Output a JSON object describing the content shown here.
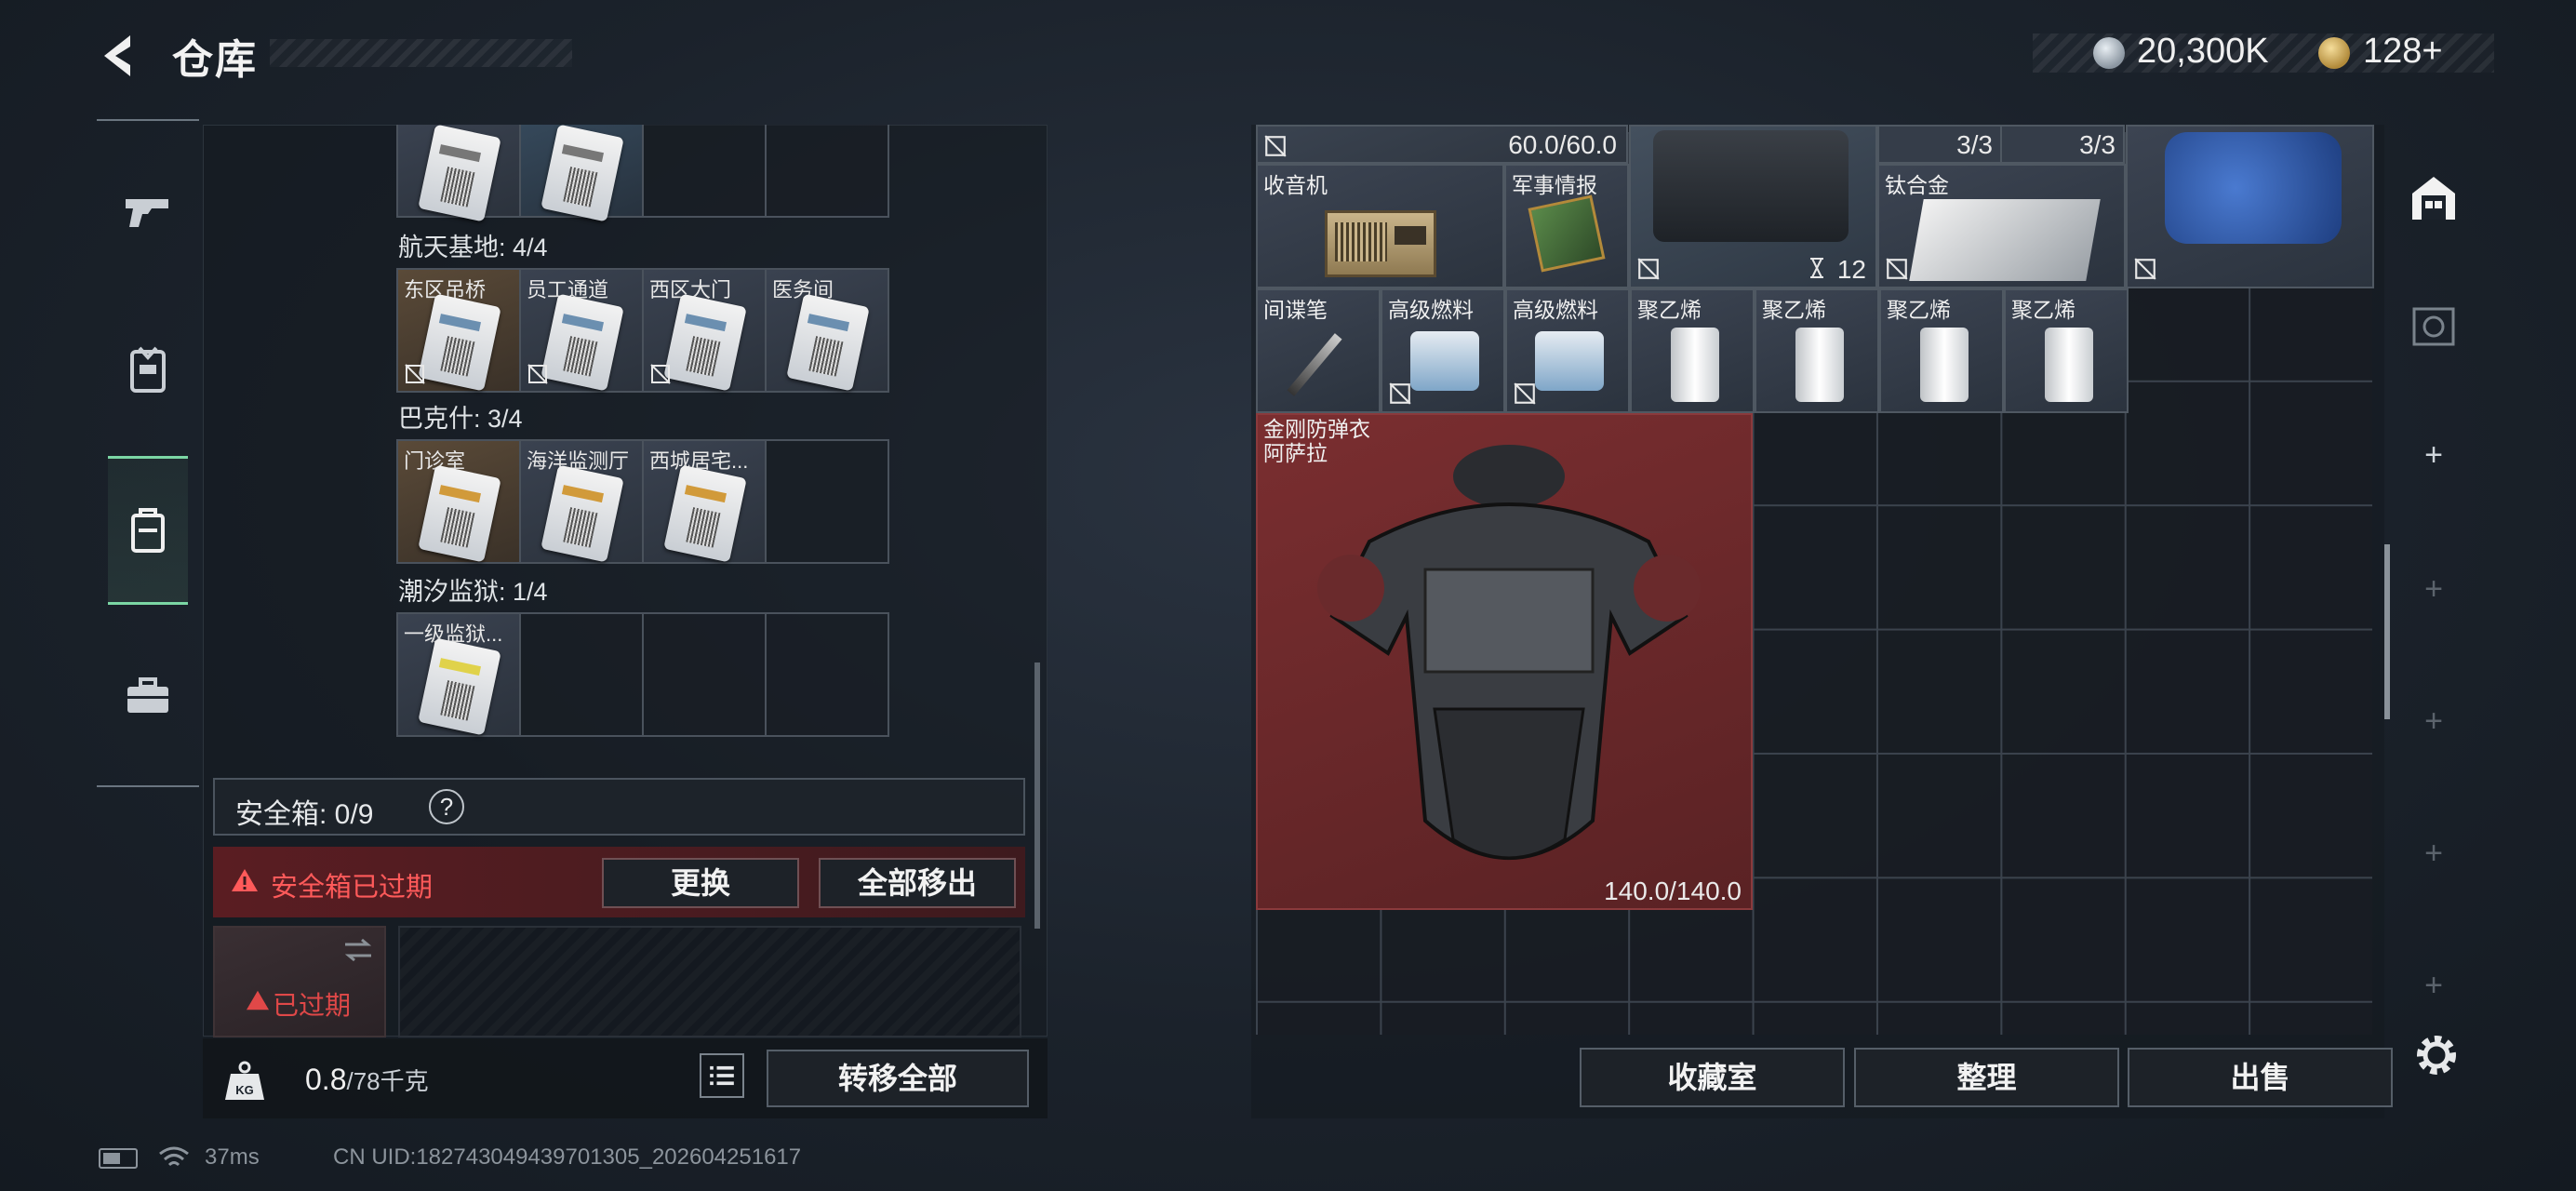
{
  "header": {
    "title": "仓库",
    "silver_amount": "20,300K",
    "gold_amount": "128+"
  },
  "left_panel": {
    "top_partial_row": [
      "",
      ""
    ],
    "sections": [
      {
        "label": "航天基地: 4/4",
        "cards": [
          "东区吊桥",
          "员工通道",
          "西区大门",
          "医务间"
        ]
      },
      {
        "label": "巴克什: 3/4",
        "cards": [
          "门诊室",
          "海洋监测厅",
          "西城居宅..."
        ]
      },
      {
        "label": "潮汐监狱: 1/4",
        "cards": [
          "一级监狱..."
        ]
      }
    ],
    "safe_box": {
      "title": "安全箱: 0/9",
      "help": "?",
      "warning": "安全箱已过期",
      "swap_label": "更换",
      "move_all_label": "全部移出",
      "expired_label": "已过期"
    },
    "bottom": {
      "weight_current": "0.8",
      "weight_max": "/78千克",
      "transfer_all_label": "转移全部"
    }
  },
  "right_panel": {
    "top_row": {
      "durability": "60.0/60.0",
      "count_a": "3/3",
      "count_b": "3/3"
    },
    "items": {
      "radio": "收音机",
      "intel": "军事情报",
      "bag_count": "12",
      "titanium": "钛合金",
      "spy_pen": "间谍笔",
      "fuel_1": "高级燃料",
      "fuel_2": "高级燃料",
      "pe_1": "聚乙烯",
      "pe_2": "聚乙烯",
      "pe_3": "聚乙烯",
      "pe_4": "聚乙烯",
      "armor_name_1": "金刚防弹衣",
      "armor_name_2": "阿萨拉",
      "armor_durability": "140.0/140.0"
    },
    "buttons": {
      "collection": "收藏室",
      "organize": "整理",
      "sell": "出售"
    }
  },
  "status": {
    "ping": "37ms",
    "uid": "CN UID:182743049439701305_202604251617"
  }
}
